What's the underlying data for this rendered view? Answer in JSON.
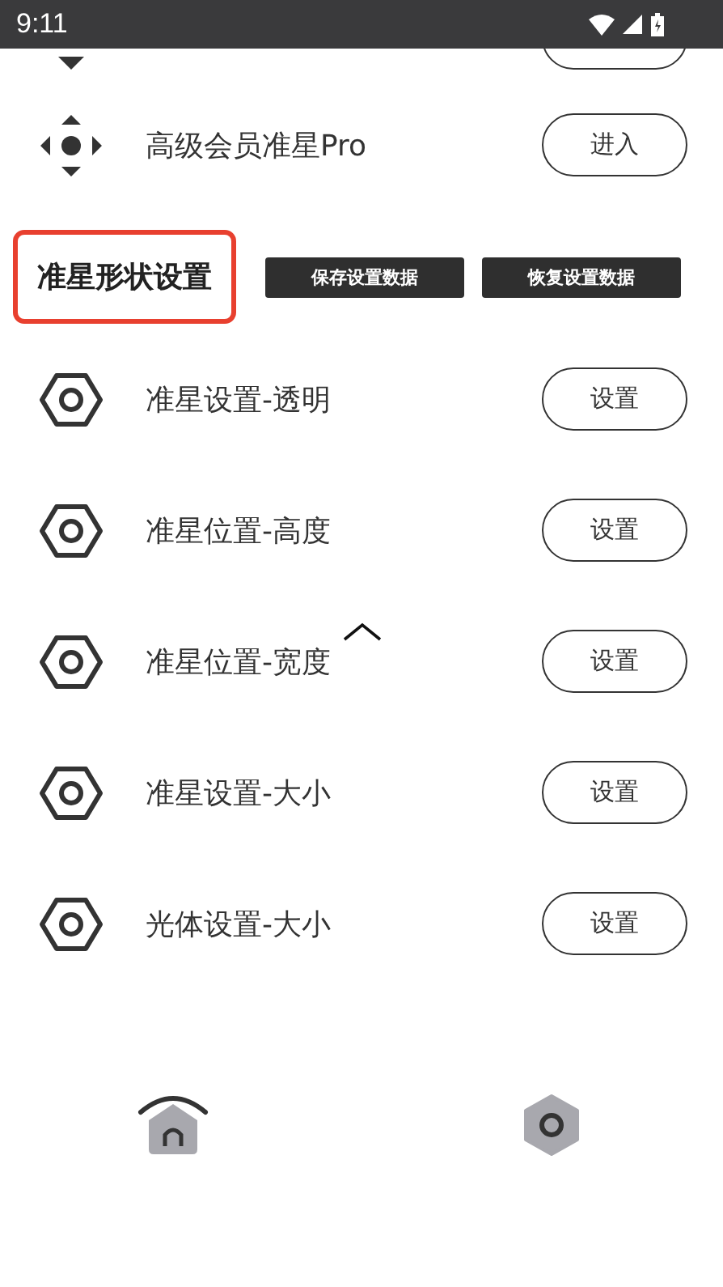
{
  "status_bar": {
    "time": "9:11"
  },
  "pro_row": {
    "label": "高级会员准星Pro",
    "button": "进入"
  },
  "section": {
    "title": "准星形状设置",
    "buttons": [
      "保存设置数据",
      "恢复设置数据"
    ]
  },
  "settings": [
    {
      "label": "准星设置-透明",
      "button": "设置"
    },
    {
      "label": "准星位置-高度",
      "button": "设置"
    },
    {
      "label": "准星位置-宽度",
      "button": "设置"
    },
    {
      "label": "准星设置-大小",
      "button": "设置"
    },
    {
      "label": "光体设置-大小",
      "button": "设置"
    }
  ]
}
